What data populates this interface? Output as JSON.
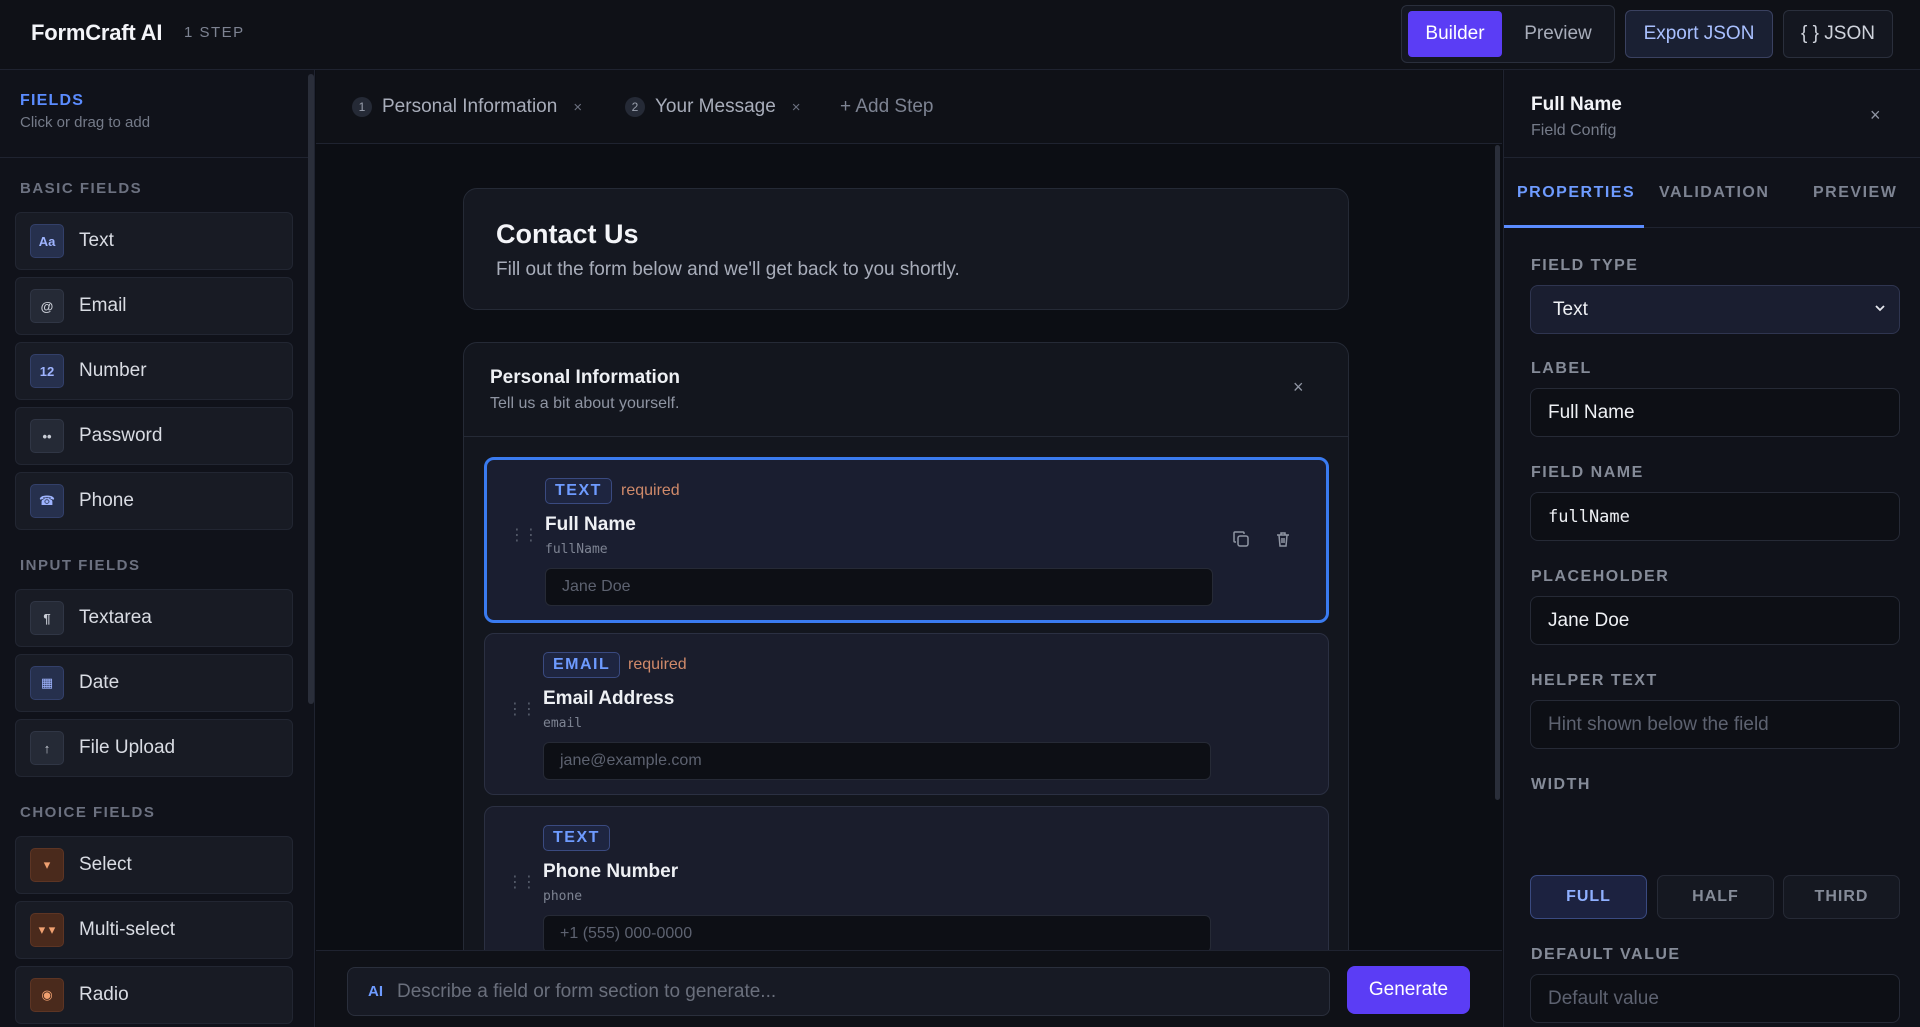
{
  "topbar": {
    "brand": "FormCraft AI",
    "step_count": "1 STEP",
    "builder_label": "Builder",
    "preview_label": "Preview",
    "export_label": "Export JSON",
    "json_label": "{ } JSON"
  },
  "sidebar": {
    "title": "FIELDS",
    "subtitle": "Click or drag to add",
    "sections": [
      {
        "title": "BASIC FIELDS",
        "items": [
          {
            "label": "Text",
            "icon": "text-icon",
            "glyph": "Aa"
          },
          {
            "label": "Email",
            "icon": "at-icon",
            "glyph": "@"
          },
          {
            "label": "Number",
            "icon": "number-icon",
            "glyph": "12"
          },
          {
            "label": "Password",
            "icon": "password-icon",
            "glyph": "••"
          },
          {
            "label": "Phone",
            "icon": "phone-icon",
            "glyph": "☎"
          }
        ]
      },
      {
        "title": "INPUT FIELDS",
        "items": [
          {
            "label": "Textarea",
            "icon": "paragraph-icon",
            "glyph": "¶"
          },
          {
            "label": "Date",
            "icon": "calendar-icon",
            "glyph": "▦"
          },
          {
            "label": "File Upload",
            "icon": "upload-icon",
            "glyph": "↑"
          }
        ]
      },
      {
        "title": "CHOICE FIELDS",
        "items": [
          {
            "label": "Select",
            "icon": "select-icon",
            "glyph": "▾"
          },
          {
            "label": "Multi-select",
            "icon": "multi-select-icon",
            "glyph": "▾ ▾"
          },
          {
            "label": "Radio",
            "icon": "radio-icon",
            "glyph": "◉"
          }
        ]
      }
    ]
  },
  "steps": {
    "tabs": [
      {
        "num": "1",
        "label": "Personal Information",
        "close": "×"
      },
      {
        "num": "2",
        "label": "Your Message",
        "close": "×"
      }
    ],
    "add_label": "+ Add Step"
  },
  "form": {
    "title": "Contact Us",
    "description": "Fill out the form below and we'll get back to you shortly."
  },
  "section": {
    "title": "Personal Information",
    "description": "Tell us a bit about yourself.",
    "close": "×",
    "fields": [
      {
        "type": "TEXT",
        "required": "required",
        "label": "Full Name",
        "name": "fullName",
        "placeholder": "Jane Doe"
      },
      {
        "type": "EMAIL",
        "required": "required",
        "label": "Email Address",
        "name": "email",
        "placeholder": "jane@example.com"
      },
      {
        "type": "TEXT",
        "required": "",
        "label": "Phone Number",
        "name": "phone",
        "placeholder": "+1 (555) 000-0000"
      }
    ]
  },
  "ai": {
    "tag": "AI",
    "placeholder": "Describe a field or form section to generate...",
    "generate_label": "Generate"
  },
  "config": {
    "title": "Full Name",
    "subtitle": "Field Config",
    "close": "×",
    "tabs": [
      "PROPERTIES",
      "VALIDATION",
      "PREVIEW"
    ],
    "field_type_label": "FIELD TYPE",
    "field_type_value": "Text",
    "label_label": "LABEL",
    "label_value": "Full Name",
    "field_name_label": "FIELD NAME",
    "field_name_value": "fullName",
    "placeholder_label": "PLACEHOLDER",
    "placeholder_value": "Jane Doe",
    "helper_label": "HELPER TEXT",
    "helper_placeholder": "Hint shown below the field",
    "width_label": "WIDTH",
    "width_options": [
      "FULL",
      "HALF",
      "THIRD"
    ],
    "width_selected": "FULL",
    "default_label": "DEFAULT VALUE",
    "default_placeholder": "Default value"
  },
  "colors": {
    "accent": "#5b3df5",
    "link_blue": "#5b8cff",
    "selected_border": "#3a7bf0",
    "required": "#d08a6a"
  }
}
